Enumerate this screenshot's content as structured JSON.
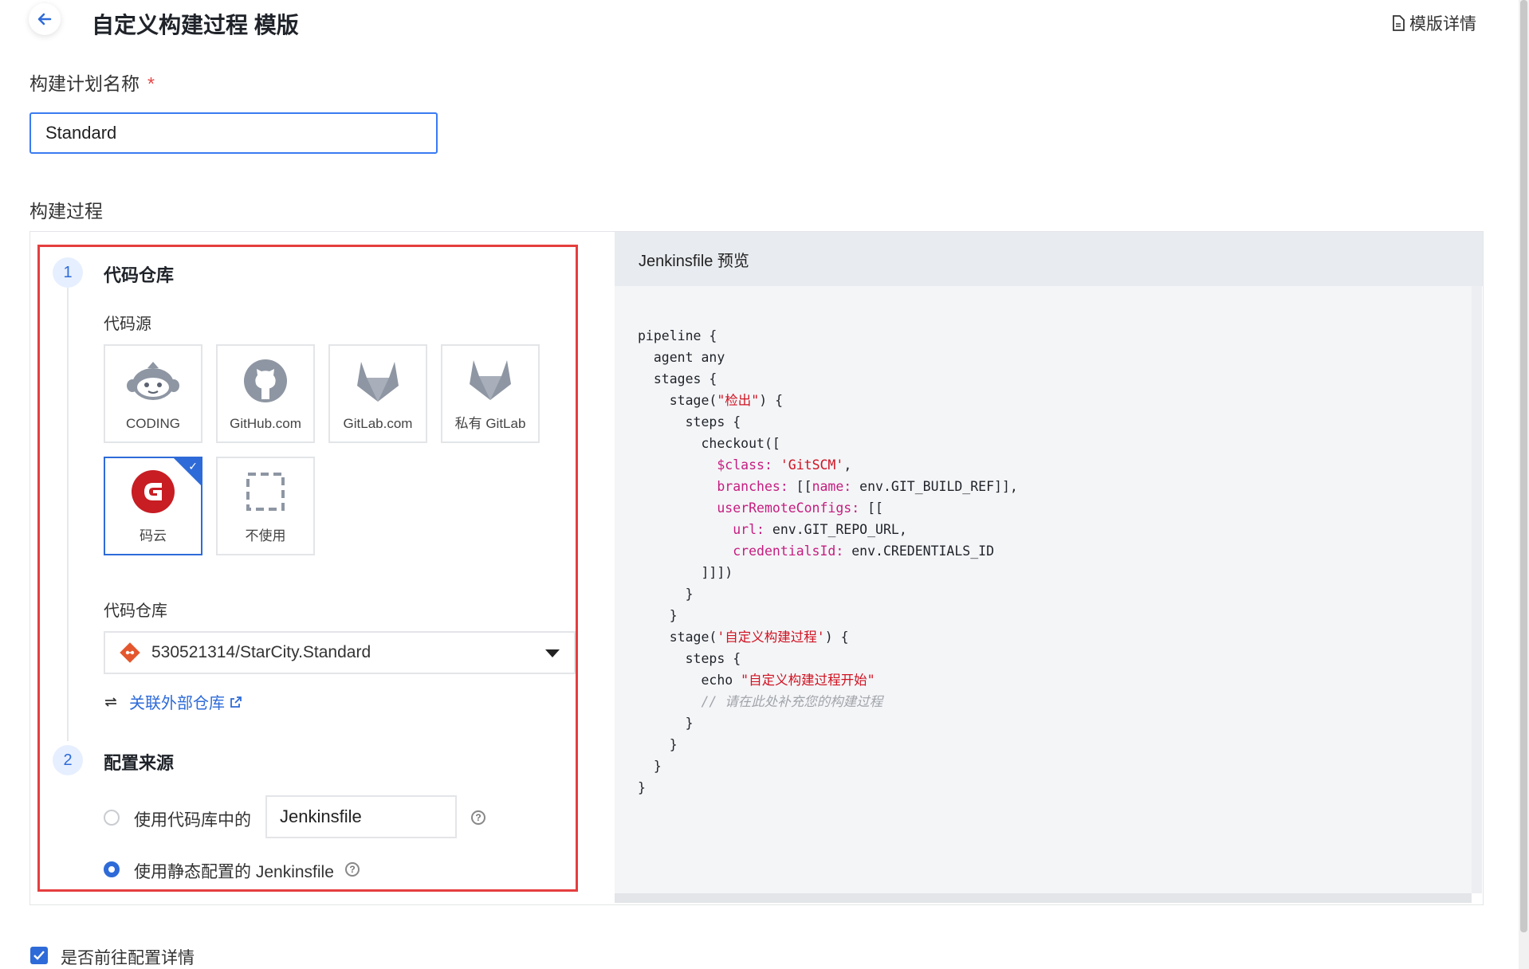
{
  "header": {
    "title": "自定义构建过程 模版",
    "template_details": "模版详情"
  },
  "plan_name": {
    "label": "构建计划名称",
    "required_mark": "*",
    "value": "Standard"
  },
  "build_process": {
    "label": "构建过程",
    "steps": [
      {
        "number": "1",
        "title": "代码仓库"
      },
      {
        "number": "2",
        "title": "配置来源"
      }
    ],
    "code_source": {
      "label": "代码源",
      "cards": [
        {
          "label": "CODING",
          "icon": "coding-monkey-icon"
        },
        {
          "label": "GitHub.com",
          "icon": "github-icon"
        },
        {
          "label": "GitLab.com",
          "icon": "gitlab-icon"
        },
        {
          "label": "私有 GitLab",
          "icon": "gitlab-icon"
        },
        {
          "label": "码云",
          "icon": "gitee-icon",
          "selected": true
        },
        {
          "label": "不使用",
          "icon": "dashed-box-icon"
        }
      ]
    },
    "repository": {
      "label": "代码仓库",
      "selected": "530521314/StarCity.Standard",
      "link_external": "关联外部仓库"
    },
    "config_source": {
      "option_repo": "使用代码库中的",
      "repo_file_value": "Jenkinsfile",
      "option_static": "使用静态配置的 Jenkinsfile",
      "selected": "static"
    }
  },
  "preview": {
    "title": "Jenkinsfile 预览"
  },
  "goto_details": {
    "label": "是否前往配置详情",
    "checked": true
  },
  "colors": {
    "accent": "#2e6bd8",
    "highlight_border": "#e53e3e",
    "keyword": "#c41d7f",
    "string": "#cf1322"
  }
}
